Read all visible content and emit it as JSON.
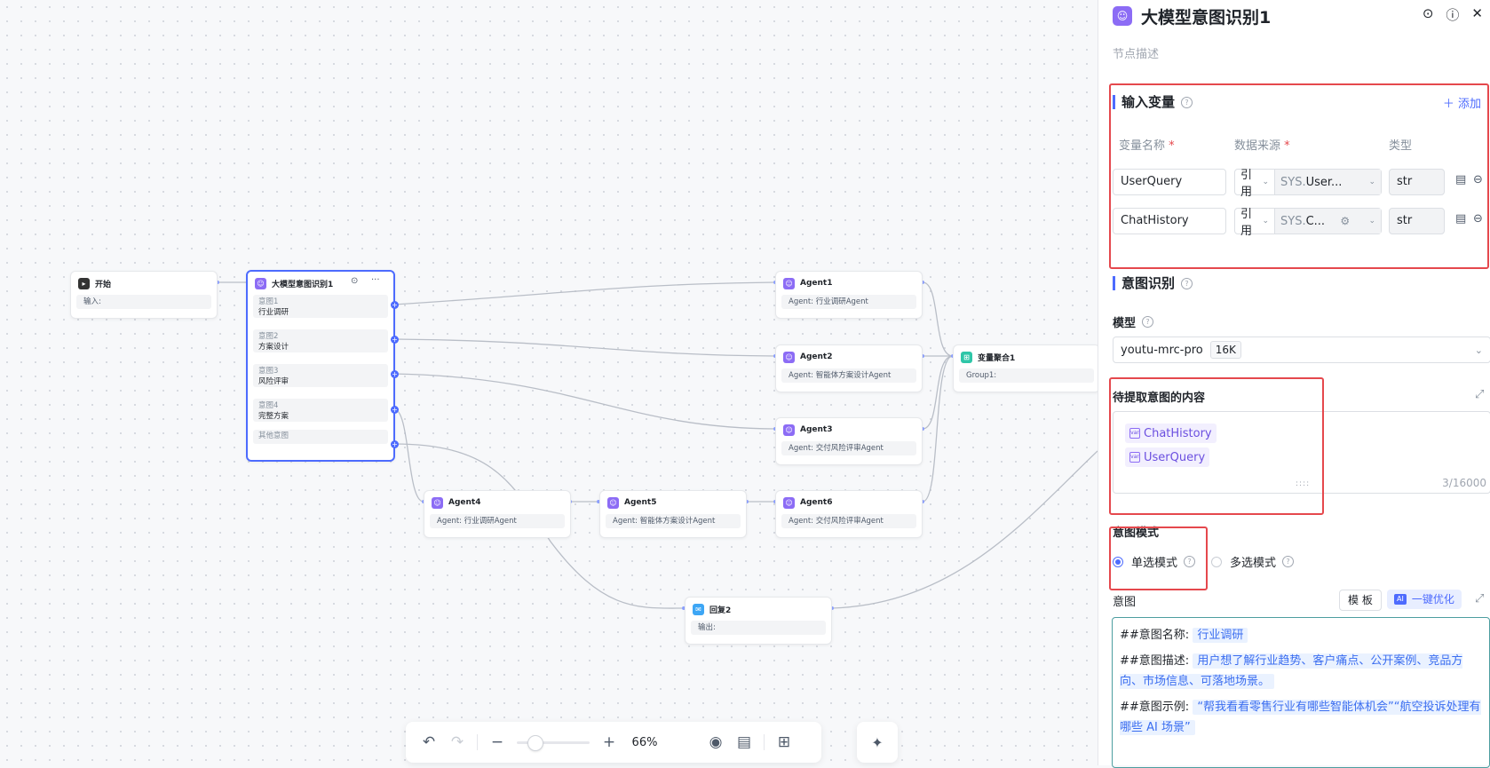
{
  "canvas": {
    "start": {
      "title": "开始",
      "body": "输入:"
    },
    "intent_node": {
      "title": "大模型意图识别1",
      "intents": [
        {
          "key": "意图1",
          "value": "行业调研"
        },
        {
          "key": "意图2",
          "value": "方案设计"
        },
        {
          "key": "意图3",
          "value": "风险评审"
        },
        {
          "key": "意图4",
          "value": "完整方案"
        }
      ],
      "other": "其他意图"
    },
    "agents": [
      {
        "title": "Agent1",
        "body": "Agent: 行业调研Agent"
      },
      {
        "title": "Agent2",
        "body": "Agent: 智能体方案设计Agent"
      },
      {
        "title": "Agent3",
        "body": "Agent: 交付风险评审Agent"
      },
      {
        "title": "Agent4",
        "body": "Agent: 行业调研Agent"
      },
      {
        "title": "Agent5",
        "body": "Agent: 智能体方案设计Agent"
      },
      {
        "title": "Agent6",
        "body": "Agent: 交付风险评审Agent"
      }
    ],
    "aggregator": {
      "title": "变量聚合1",
      "body": "Group1:"
    },
    "reply": {
      "title": "回复2",
      "body": "输出:"
    }
  },
  "toolbar": {
    "zoom": "66%",
    "zoom_level_percent": 66
  },
  "panel": {
    "title": "大模型意图识别1",
    "description_placeholder": "节点描述",
    "inputs": {
      "title": "输入变量",
      "add_label": "添加",
      "col_name": "变量名称",
      "col_source": "数据来源",
      "col_type": "类型",
      "rows": [
        {
          "name": "UserQuery",
          "mode": "引用",
          "source_prefix": "SYS.",
          "source_value": "User...",
          "type": "str"
        },
        {
          "name": "ChatHistory",
          "mode": "引用",
          "source_prefix": "SYS.",
          "source_value": "C...",
          "type": "str"
        }
      ]
    },
    "recognition": {
      "title": "意图识别",
      "model_label": "模型",
      "model_value": "youtu-mrc-pro",
      "model_tag": "16K",
      "content_label": "待提取意图的内容",
      "content_vars": [
        "ChatHistory",
        "UserQuery"
      ],
      "content_counter": "3/16000",
      "mode_label": "意图模式",
      "mode_single": "单选模式",
      "mode_multi": "多选模式",
      "intent_label": "意图",
      "template_btn": "模 板",
      "ai_badge": "AI",
      "ai_btn": "一键优化",
      "intent_text": {
        "name_label": "##意图名称:",
        "name_value": "行业调研",
        "desc_label": "##意图描述:",
        "desc_value": "用户想了解行业趋势、客户痛点、公开案例、竞品方向、市场信息、可落地场景。",
        "example_label": "##意图示例:",
        "example_value": "“帮我看看零售行业有哪些智能体机会”“航空投诉处理有哪些 AI 场景”"
      }
    }
  }
}
